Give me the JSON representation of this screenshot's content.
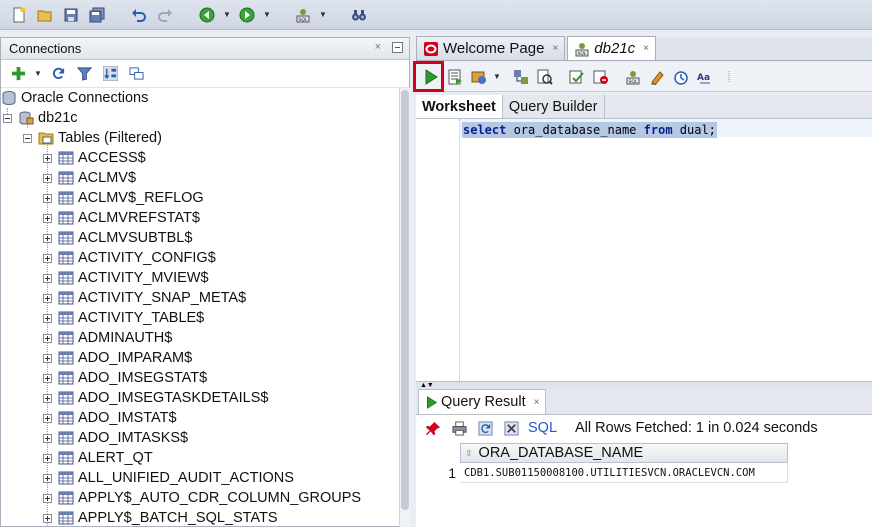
{
  "toolbar": {
    "icons": [
      "new-icon",
      "open-folder-icon",
      "save-icon",
      "save-all-icon",
      "undo-icon",
      "redo-icon",
      "back-icon",
      "forward-icon",
      "sql-worksheet-icon",
      "binoculars-icon"
    ]
  },
  "connections_panel": {
    "title": "Connections",
    "close_glyph": "×",
    "tree": {
      "root": "Oracle Connections",
      "connection": "db21c",
      "folder": "Tables (Filtered)",
      "tables": [
        "ACCESS$",
        "ACLMV$",
        "ACLMV$_REFLOG",
        "ACLMVREFSTAT$",
        "ACLMVSUBTBL$",
        "ACTIVITY_CONFIG$",
        "ACTIVITY_MVIEW$",
        "ACTIVITY_SNAP_META$",
        "ACTIVITY_TABLE$",
        "ADMINAUTH$",
        "ADO_IMPARAM$",
        "ADO_IMSEGSTAT$",
        "ADO_IMSEGTASKDETAILS$",
        "ADO_IMSTAT$",
        "ADO_IMTASKS$",
        "ALERT_QT",
        "ALL_UNIFIED_AUDIT_ACTIONS",
        "APPLY$_AUTO_CDR_COLUMN_GROUPS",
        "APPLY$_BATCH_SQL_STATS"
      ]
    }
  },
  "doc_tabs": [
    {
      "label": "Welcome Page",
      "close": "×"
    },
    {
      "label": "db21c",
      "close": "×"
    }
  ],
  "worksheet": {
    "subtabs": [
      "Worksheet",
      "Query Builder"
    ],
    "sql": {
      "kw1": "select",
      "mid": " ora_database_name ",
      "kw2": "from",
      "tail": " dual;"
    }
  },
  "results": {
    "tab_label": "Query Result",
    "tab_close": "×",
    "sql_link": "SQL",
    "status": "All Rows Fetched: 1 in 0.024 seconds",
    "column": "ORA_DATABASE_NAME",
    "rows": [
      {
        "num": "1",
        "value": "CDB1.SUB01150008100.UTILITIESVCN.ORACLEVCN.COM"
      }
    ]
  },
  "colors": {
    "run_highlight": "#d0021b",
    "run_green": "#2e9a2e",
    "selection": "#b4c8e6"
  }
}
